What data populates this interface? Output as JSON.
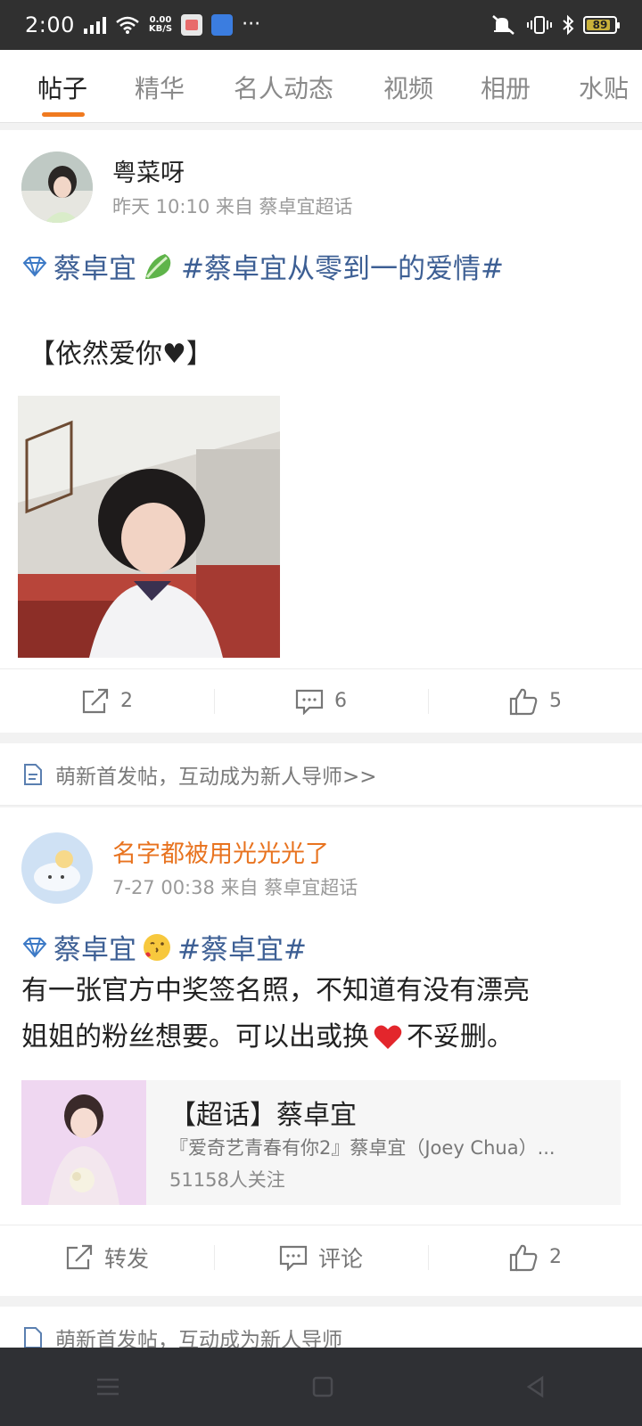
{
  "status_bar": {
    "time": "2:00",
    "net_speed_value": "0.00",
    "net_speed_unit": "KB/S",
    "more": "···",
    "battery": "89"
  },
  "tabs": [
    {
      "label": "帖子",
      "active": true
    },
    {
      "label": "精华"
    },
    {
      "label": "名人动态"
    },
    {
      "label": "视频"
    },
    {
      "label": "相册"
    },
    {
      "label": "水贴"
    }
  ],
  "post1": {
    "username": "粤菜呀",
    "meta": "昨天 10:10 来自 蔡卓宜超话",
    "topic_name": "蔡卓宜",
    "hashtag": "#蔡卓宜从零到一的爱情#",
    "body": "【依然爱你♥】",
    "actions": {
      "repost": "2",
      "comment": "6",
      "like": "5"
    }
  },
  "notice": {
    "text": "萌新首发帖，互动成为新人导师>>"
  },
  "post2": {
    "username": "名字都被用光光光了",
    "meta": "7-27 00:38 来自 蔡卓宜超话",
    "topic_name": "蔡卓宜",
    "hashtag": "#蔡卓宜#",
    "body_line1": "有一张官方中奖签名照，不知道有没有漂亮",
    "body_line2": "姐姐的粉丝想要。可以出或换",
    "body_line2_end": "不妥删。",
    "card": {
      "title": "【超话】蔡卓宜",
      "desc": "『爱奇艺青春有你2』蔡卓宜（Joey Chua）...",
      "followers": "51158人关注"
    },
    "actions": {
      "repost": "转发",
      "comment": "评论",
      "like": "2"
    }
  },
  "notice_partial": {
    "text": "萌新首发帖，互动成为新人导师"
  },
  "colors": {
    "accent": "#f07a1f",
    "topic": "#3d5f94",
    "orange_name": "#e8731f"
  }
}
